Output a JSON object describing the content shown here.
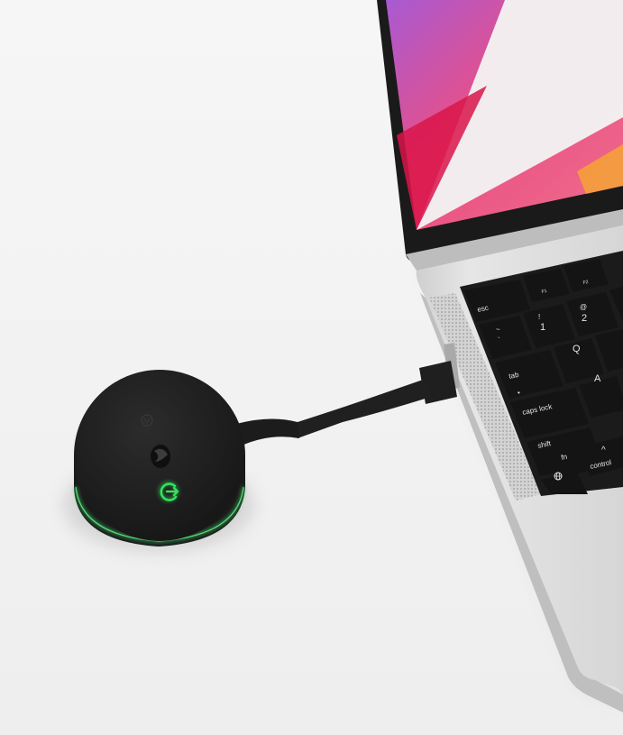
{
  "scene": {
    "subject": "wireless presentation transmitter dongle connected to a laptop USB-C port",
    "colors": {
      "background": "#f3f3f3",
      "laptop_body": "#d9d9d9",
      "keyboard_well": "#1b1b1c",
      "key": "#141414",
      "dongle_body": "#1e1e1e",
      "ring_glow": "#3fd56a",
      "led_icon": "#31e35a",
      "wallpaper_pink": "#ea4f84",
      "wallpaper_purple": "#a85ad3",
      "wallpaper_red": "#d9154a"
    },
    "icons": {
      "dongle_logo": "brand-logo-icon",
      "dongle_top_badge": "badge-icon",
      "dongle_led": "share-screen-icon"
    }
  },
  "keyboard": {
    "keys": {
      "esc": "esc",
      "f1": "F1",
      "f2": "F2",
      "tilde_top": "~",
      "tilde_bottom": "`",
      "one_top": "!",
      "one_bottom": "1",
      "two_top": "@",
      "two_bottom": "2",
      "tab": "tab",
      "q": "Q",
      "caps_dot": "•",
      "caps": "caps lock",
      "a": "A",
      "shift": "shift",
      "fn": "fn",
      "control_glyph": "^",
      "control": "control"
    }
  }
}
